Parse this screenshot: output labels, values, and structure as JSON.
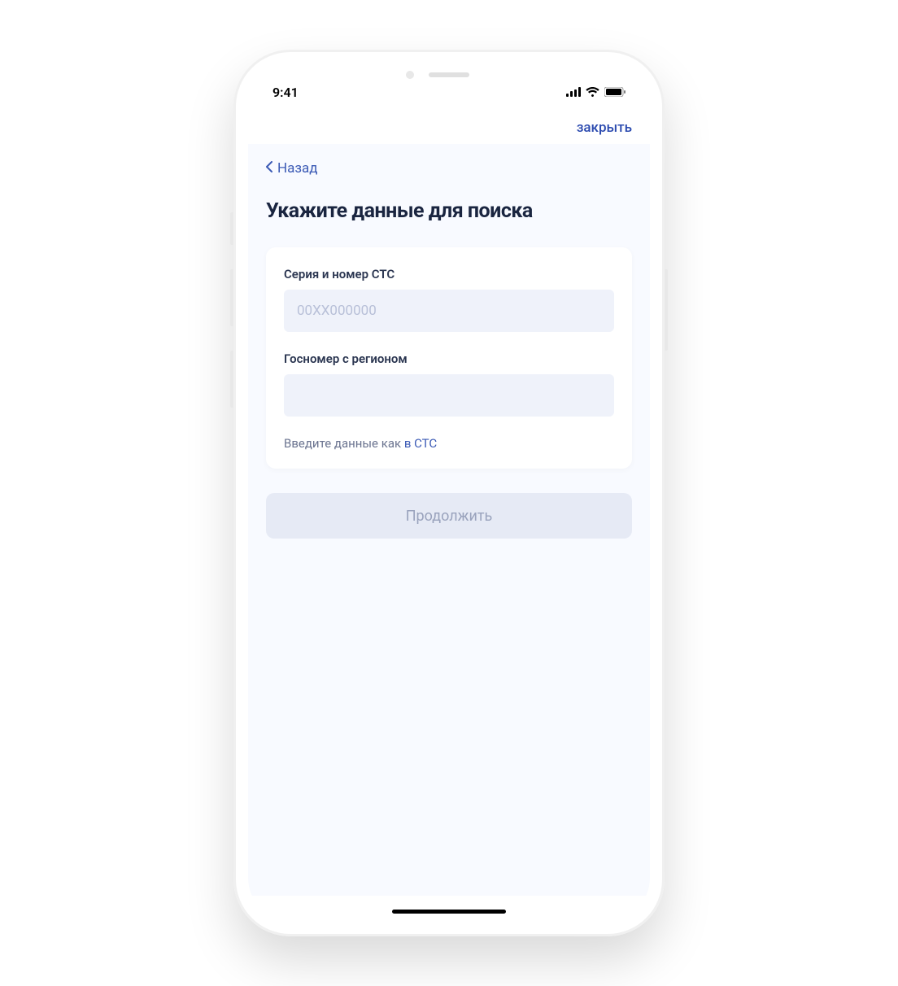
{
  "status_bar": {
    "time": "9:41"
  },
  "app_bar": {
    "close_label": "закрыть"
  },
  "nav": {
    "back_label": "Назад"
  },
  "page": {
    "title": "Укажите данные для поиска"
  },
  "form": {
    "sts": {
      "label": "Серия и номер СТС",
      "placeholder": "00ХХ000000",
      "value": ""
    },
    "plate": {
      "label": "Госномер с регионом",
      "placeholder": "",
      "value": ""
    },
    "hint_prefix": "Введите данные как ",
    "hint_link": "в СТС"
  },
  "actions": {
    "continue_label": "Продолжить"
  }
}
